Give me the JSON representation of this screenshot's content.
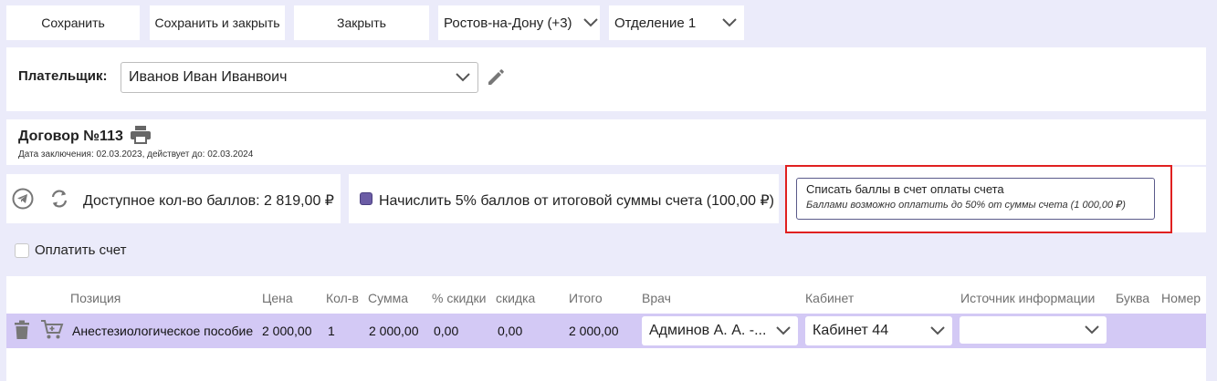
{
  "toolbar": {
    "save_label": "Сохранить",
    "save_close_label": "Сохранить и закрыть",
    "close_label": "Закрыть",
    "city_value": "Ростов-на-Дону (+3)",
    "department_value": "Отделение 1"
  },
  "payer": {
    "label": "Плательщик:",
    "value": "Иванов Иван Иванвоич"
  },
  "contract": {
    "title": "Договор №113",
    "dates": "Дата заключения: 02.03.2023, действует до: 02.03.2024"
  },
  "points": {
    "available": "Доступное кол-во баллов: 2 819,00 ₽",
    "accrue_label": "Начислить 5% баллов от итоговой суммы счета (100,00 ₽)",
    "accrue_checked": true,
    "writeoff_title": "Списать баллы в счет оплаты счета",
    "writeoff_note": "Баллами возможно оплатить до 50% от суммы счета (1 000,00 ₽)"
  },
  "pay": {
    "label": "Оплатить счет",
    "checked": false
  },
  "table": {
    "headers": {
      "position": "Позиция",
      "price": "Цена",
      "qty": "Кол-в",
      "sum": "Сумма",
      "discount_pct": "% скидки",
      "discount": "скидка",
      "total": "Итого",
      "doctor": "Врач",
      "room": "Кабинет",
      "source": "Источник информации",
      "letter": "Буква",
      "number": "Номер"
    },
    "rows": [
      {
        "position": "Анестезиологическое пособие",
        "price": "2 000,00",
        "qty": "1",
        "sum": "2 000,00",
        "discount_pct": "0,00",
        "discount": "0,00",
        "total": "2 000,00",
        "doctor": "Админов А. А. -...",
        "room": "Кабинет 44",
        "source": ""
      }
    ]
  },
  "colors": {
    "background": "#ebebfa",
    "row_highlight": "#d3c9f5",
    "accent_checkbox": "#6b5ca5",
    "annotation_red": "#e02020"
  }
}
